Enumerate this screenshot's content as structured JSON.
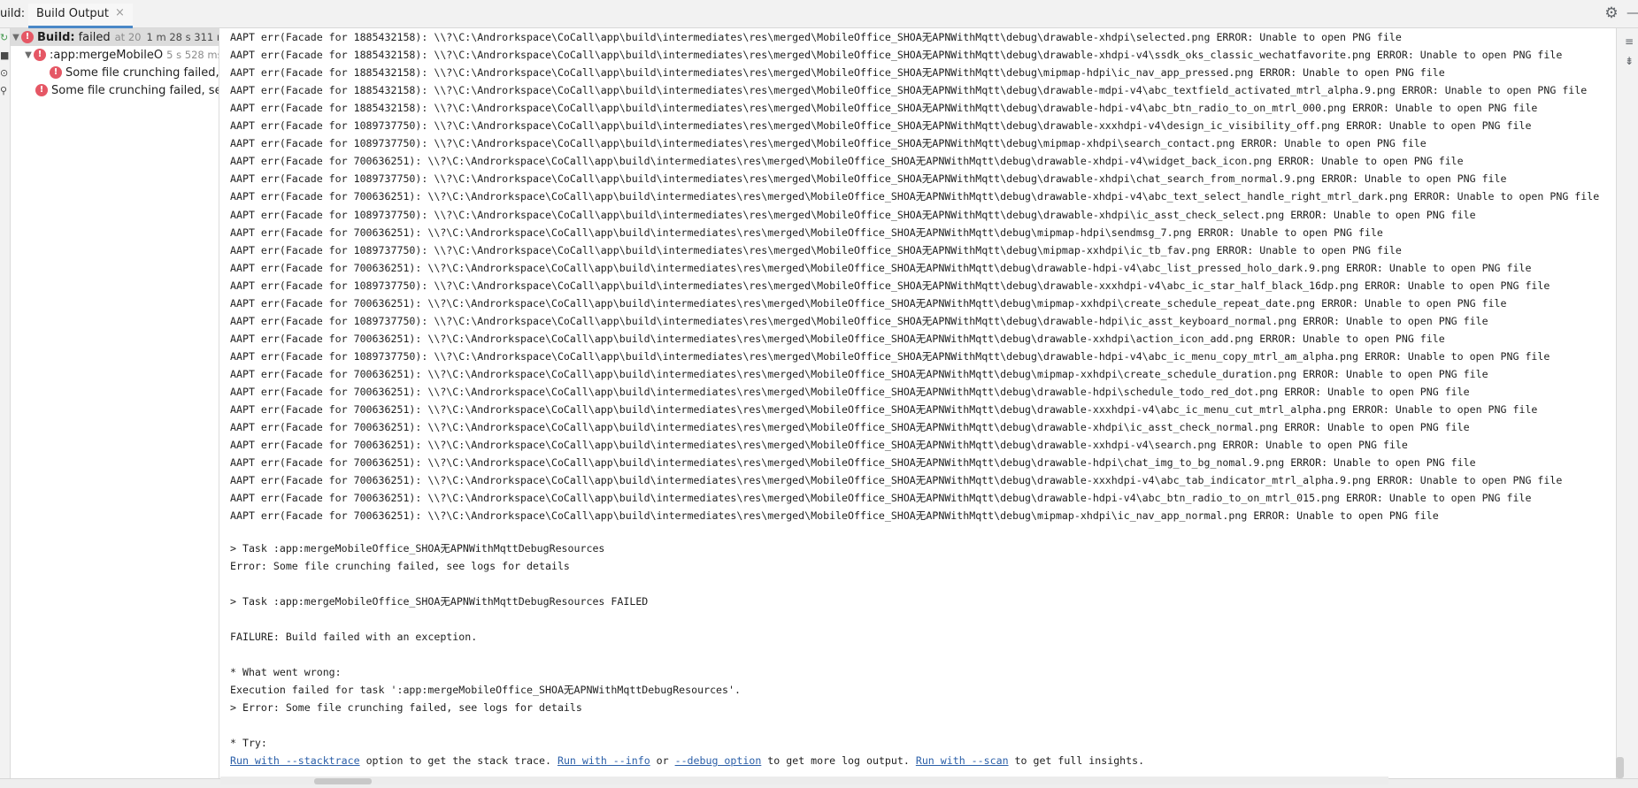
{
  "header": {
    "prefix": "uild:",
    "tab_label": "Build Output",
    "tab_close": "×"
  },
  "icons": {
    "settings": "gear-icon",
    "minimize": "minimize-icon",
    "error": "error-icon"
  },
  "tree": {
    "root": {
      "label_bold": "Build:",
      "label_status": "failed",
      "label_time": "at 20",
      "duration": "1 m 28 s 311 ms"
    },
    "task": {
      "label": ":app:mergeMobileO",
      "duration": "5 s 528 ms"
    },
    "child_error": "Some file crunching failed, s",
    "top_error": "Some file crunching failed, see"
  },
  "console": {
    "log_lines": [
      "AAPT err(Facade for 1885432158): \\\\?\\C:\\Androrkspace\\CoCall\\app\\build\\intermediates\\res\\merged\\MobileOffice_SHOA无APNWithMqtt\\debug\\drawable-xhdpi\\selected.png ERROR: Unable to open PNG file",
      "AAPT err(Facade for 1885432158): \\\\?\\C:\\Androrkspace\\CoCall\\app\\build\\intermediates\\res\\merged\\MobileOffice_SHOA无APNWithMqtt\\debug\\drawable-xhdpi-v4\\ssdk_oks_classic_wechatfavorite.png ERROR: Unable to open PNG file",
      "AAPT err(Facade for 1885432158): \\\\?\\C:\\Androrkspace\\CoCall\\app\\build\\intermediates\\res\\merged\\MobileOffice_SHOA无APNWithMqtt\\debug\\mipmap-hdpi\\ic_nav_app_pressed.png ERROR: Unable to open PNG file",
      "AAPT err(Facade for 1885432158): \\\\?\\C:\\Androrkspace\\CoCall\\app\\build\\intermediates\\res\\merged\\MobileOffice_SHOA无APNWithMqtt\\debug\\drawable-mdpi-v4\\abc_textfield_activated_mtrl_alpha.9.png ERROR: Unable to open PNG file",
      "AAPT err(Facade for 1885432158): \\\\?\\C:\\Androrkspace\\CoCall\\app\\build\\intermediates\\res\\merged\\MobileOffice_SHOA无APNWithMqtt\\debug\\drawable-hdpi-v4\\abc_btn_radio_to_on_mtrl_000.png ERROR: Unable to open PNG file",
      "AAPT err(Facade for 1089737750): \\\\?\\C:\\Androrkspace\\CoCall\\app\\build\\intermediates\\res\\merged\\MobileOffice_SHOA无APNWithMqtt\\debug\\drawable-xxxhdpi-v4\\design_ic_visibility_off.png ERROR: Unable to open PNG file",
      "AAPT err(Facade for 1089737750): \\\\?\\C:\\Androrkspace\\CoCall\\app\\build\\intermediates\\res\\merged\\MobileOffice_SHOA无APNWithMqtt\\debug\\mipmap-xhdpi\\search_contact.png ERROR: Unable to open PNG file",
      "AAPT err(Facade for 700636251): \\\\?\\C:\\Androrkspace\\CoCall\\app\\build\\intermediates\\res\\merged\\MobileOffice_SHOA无APNWithMqtt\\debug\\drawable-xhdpi-v4\\widget_back_icon.png ERROR: Unable to open PNG file",
      "AAPT err(Facade for 1089737750): \\\\?\\C:\\Androrkspace\\CoCall\\app\\build\\intermediates\\res\\merged\\MobileOffice_SHOA无APNWithMqtt\\debug\\drawable-xhdpi\\chat_search_from_normal.9.png ERROR: Unable to open PNG file",
      "AAPT err(Facade for 700636251): \\\\?\\C:\\Androrkspace\\CoCall\\app\\build\\intermediates\\res\\merged\\MobileOffice_SHOA无APNWithMqtt\\debug\\drawable-xhdpi-v4\\abc_text_select_handle_right_mtrl_dark.png ERROR: Unable to open PNG file",
      "AAPT err(Facade for 1089737750): \\\\?\\C:\\Androrkspace\\CoCall\\app\\build\\intermediates\\res\\merged\\MobileOffice_SHOA无APNWithMqtt\\debug\\drawable-xhdpi\\ic_asst_check_select.png ERROR: Unable to open PNG file",
      "AAPT err(Facade for 700636251): \\\\?\\C:\\Androrkspace\\CoCall\\app\\build\\intermediates\\res\\merged\\MobileOffice_SHOA无APNWithMqtt\\debug\\mipmap-hdpi\\sendmsg_7.png ERROR: Unable to open PNG file",
      "AAPT err(Facade for 1089737750): \\\\?\\C:\\Androrkspace\\CoCall\\app\\build\\intermediates\\res\\merged\\MobileOffice_SHOA无APNWithMqtt\\debug\\mipmap-xxhdpi\\ic_tb_fav.png ERROR: Unable to open PNG file",
      "AAPT err(Facade for 700636251): \\\\?\\C:\\Androrkspace\\CoCall\\app\\build\\intermediates\\res\\merged\\MobileOffice_SHOA无APNWithMqtt\\debug\\drawable-hdpi-v4\\abc_list_pressed_holo_dark.9.png ERROR: Unable to open PNG file",
      "AAPT err(Facade for 1089737750): \\\\?\\C:\\Androrkspace\\CoCall\\app\\build\\intermediates\\res\\merged\\MobileOffice_SHOA无APNWithMqtt\\debug\\drawable-xxxhdpi-v4\\abc_ic_star_half_black_16dp.png ERROR: Unable to open PNG file",
      "AAPT err(Facade for 700636251): \\\\?\\C:\\Androrkspace\\CoCall\\app\\build\\intermediates\\res\\merged\\MobileOffice_SHOA无APNWithMqtt\\debug\\mipmap-xxhdpi\\create_schedule_repeat_date.png ERROR: Unable to open PNG file",
      "AAPT err(Facade for 1089737750): \\\\?\\C:\\Androrkspace\\CoCall\\app\\build\\intermediates\\res\\merged\\MobileOffice_SHOA无APNWithMqtt\\debug\\drawable-hdpi\\ic_asst_keyboard_normal.png ERROR: Unable to open PNG file",
      "AAPT err(Facade for 700636251): \\\\?\\C:\\Androrkspace\\CoCall\\app\\build\\intermediates\\res\\merged\\MobileOffice_SHOA无APNWithMqtt\\debug\\drawable-xxhdpi\\action_icon_add.png ERROR: Unable to open PNG file",
      "AAPT err(Facade for 1089737750): \\\\?\\C:\\Androrkspace\\CoCall\\app\\build\\intermediates\\res\\merged\\MobileOffice_SHOA无APNWithMqtt\\debug\\drawable-hdpi-v4\\abc_ic_menu_copy_mtrl_am_alpha.png ERROR: Unable to open PNG file",
      "AAPT err(Facade for 700636251): \\\\?\\C:\\Androrkspace\\CoCall\\app\\build\\intermediates\\res\\merged\\MobileOffice_SHOA无APNWithMqtt\\debug\\mipmap-xxhdpi\\create_schedule_duration.png ERROR: Unable to open PNG file",
      "AAPT err(Facade for 700636251): \\\\?\\C:\\Androrkspace\\CoCall\\app\\build\\intermediates\\res\\merged\\MobileOffice_SHOA无APNWithMqtt\\debug\\drawable-hdpi\\schedule_todo_red_dot.png ERROR: Unable to open PNG file",
      "AAPT err(Facade for 700636251): \\\\?\\C:\\Androrkspace\\CoCall\\app\\build\\intermediates\\res\\merged\\MobileOffice_SHOA无APNWithMqtt\\debug\\drawable-xxxhdpi-v4\\abc_ic_menu_cut_mtrl_alpha.png ERROR: Unable to open PNG file",
      "AAPT err(Facade for 700636251): \\\\?\\C:\\Androrkspace\\CoCall\\app\\build\\intermediates\\res\\merged\\MobileOffice_SHOA无APNWithMqtt\\debug\\drawable-xhdpi\\ic_asst_check_normal.png ERROR: Unable to open PNG file",
      "AAPT err(Facade for 700636251): \\\\?\\C:\\Androrkspace\\CoCall\\app\\build\\intermediates\\res\\merged\\MobileOffice_SHOA无APNWithMqtt\\debug\\drawable-xxhdpi-v4\\search.png ERROR: Unable to open PNG file",
      "AAPT err(Facade for 700636251): \\\\?\\C:\\Androrkspace\\CoCall\\app\\build\\intermediates\\res\\merged\\MobileOffice_SHOA无APNWithMqtt\\debug\\drawable-hdpi\\chat_img_to_bg_nomal.9.png ERROR: Unable to open PNG file",
      "AAPT err(Facade for 700636251): \\\\?\\C:\\Androrkspace\\CoCall\\app\\build\\intermediates\\res\\merged\\MobileOffice_SHOA无APNWithMqtt\\debug\\drawable-xxxhdpi-v4\\abc_tab_indicator_mtrl_alpha.9.png ERROR: Unable to open PNG file",
      "AAPT err(Facade for 700636251): \\\\?\\C:\\Androrkspace\\CoCall\\app\\build\\intermediates\\res\\merged\\MobileOffice_SHOA无APNWithMqtt\\debug\\drawable-hdpi-v4\\abc_btn_radio_to_on_mtrl_015.png ERROR: Unable to open PNG file",
      "AAPT err(Facade for 700636251): \\\\?\\C:\\Androrkspace\\CoCall\\app\\build\\intermediates\\res\\merged\\MobileOffice_SHOA无APNWithMqtt\\debug\\mipmap-xhdpi\\ic_nav_app_normal.png ERROR: Unable to open PNG file"
    ],
    "task_line": "> Task :app:mergeMobileOffice_SHOA无APNWithMqttDebugResources",
    "error_line": "Error: Some file crunching failed, see logs for details",
    "task_failed_line": "> Task :app:mergeMobileOffice_SHOA无APNWithMqttDebugResources FAILED",
    "failure_line": "FAILURE: Build failed with an exception.",
    "wrong_heading": "* What went wrong:",
    "execution_line": "Execution failed for task ':app:mergeMobileOffice_SHOA无APNWithMqttDebugResources'.",
    "cause_line": "> Error: Some file crunching failed, see logs for details",
    "try_heading": "* Try:",
    "try": {
      "link_stacktrace": "Run with --stacktrace",
      "text_1": " option to get the stack trace. ",
      "link_info": "Run with --info",
      "text_2": " or ",
      "link_debug": "--debug option",
      "text_3": " to get more log output. ",
      "link_scan": "Run with --scan",
      "text_4": " to get full insights."
    }
  },
  "colors": {
    "error_red": "#e55765",
    "link_blue": "#2b5fa8",
    "tab_underline": "#4a88c7",
    "selection": "#dcdcdc"
  }
}
